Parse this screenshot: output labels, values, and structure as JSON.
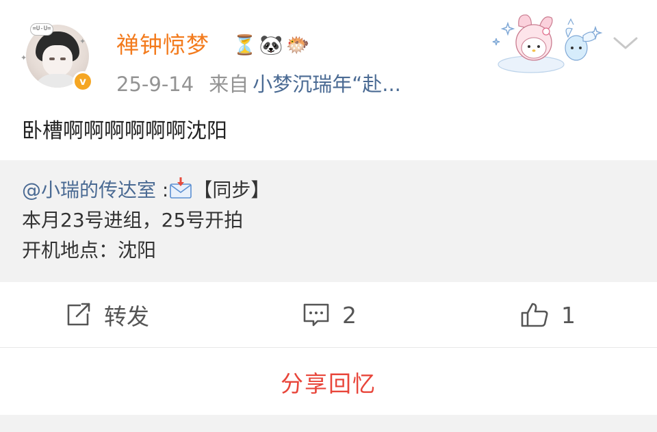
{
  "user": {
    "name": "禅钟惊梦",
    "badges": [
      "⏳",
      "🐼",
      "🐡"
    ],
    "verified": true,
    "avatar_bubble_text": "=U-U="
  },
  "post": {
    "time": "25-9-14",
    "from_label": "来自",
    "source": "小梦沉瑞年“赴...",
    "text": "卧槽啊啊啊啊啊啊沈阳"
  },
  "retweet": {
    "mention": "@小瑞的传达室",
    "mention_suffix": " :",
    "tag": "【同步】",
    "line2": "本月23号进组，25号开拍",
    "line3": "开机地点：沈阳"
  },
  "actions": {
    "repost_label": "转发",
    "comment_count": "2",
    "like_count": "1"
  },
  "footer": {
    "share_memory_label": "分享回忆"
  },
  "icons": {
    "avatar": "avatar-image",
    "verified": "verified-icon",
    "sticker": "my-melody-sticker",
    "more": "chevron-down-icon",
    "envelope": "envelope-icon",
    "repost": "share-icon",
    "comment": "comment-icon",
    "like": "thumbs-up-icon"
  },
  "colors": {
    "username": "#f37b1d",
    "link": "#4a6a93",
    "accent_red": "#e8453a",
    "meta_gray": "#939393",
    "retweet_bg": "#f2f2f2"
  }
}
